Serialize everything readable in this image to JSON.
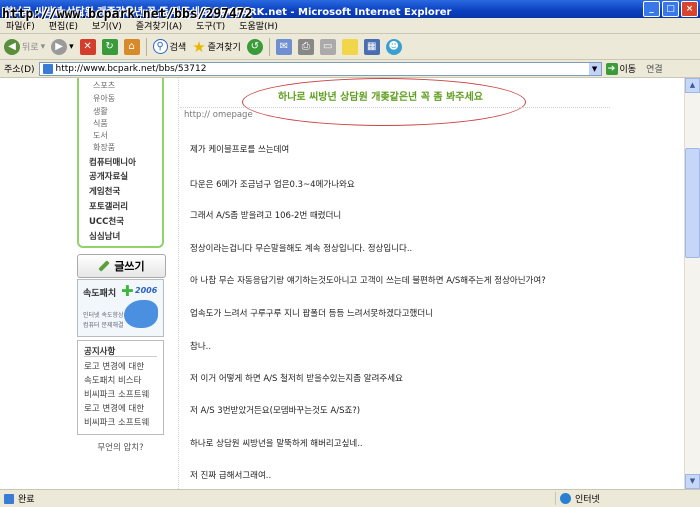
{
  "window": {
    "title": "하나로 씨방년 상담원 개좆같은년 꼭 좀 봐주세요 : BCPARK.net - Microsoft Internet Explorer",
    "watermark_url": "http://www.bcpark.net/bbs/297472",
    "buttons": [
      "_",
      "□",
      "×"
    ]
  },
  "menubar": [
    "파일(F)",
    "편집(E)",
    "보기(V)",
    "즐겨찾기(A)",
    "도구(T)",
    "도움말(H)"
  ],
  "toolbar": {
    "back": "뒤로",
    "search": "검색",
    "favorites": "즐겨찾기"
  },
  "address": {
    "label": "주소(D)",
    "url": "http://www.bcpark.net/bbs/53712",
    "go": "이동",
    "links": "연결"
  },
  "sidebar": {
    "subcategories": [
      "스포츠",
      "유아동",
      "생활",
      "식품",
      "도서",
      "화장품"
    ],
    "categories": [
      "컴퓨터매니아",
      "공개자료실",
      "게임천국",
      "포토갤러리",
      "UCC천국",
      "심심남녀"
    ],
    "write_button": "글쓰기",
    "banner": {
      "title": "속도패치",
      "year": "2006",
      "line1": "인터넷 속도향상",
      "line2": "컴퓨터 문제해결"
    },
    "notice": {
      "title": "공지사항",
      "items": [
        "로고 변경에 대한",
        "속도패치 비스타",
        "비씨파크 소프트웨",
        "로고 변경에 대한",
        "비씨파크 소프트웨"
      ]
    },
    "unknown": "무언의 압치?"
  },
  "post": {
    "title": "하나로 씨방년 상담원 개좆같은년 꼭 좀 봐주세요",
    "homepage": "http:// omepage",
    "paragraphs": [
      "제가 케이블프로를 쓰는데여",
      "다운은 6메가 조금넘구 업은0.3~4메가나와요",
      "그래서 A/S좀 받을려고 106-2번 때렸더니",
      "정상이라는겁니다 무슨말을해도 계속 정상입니다. 정상입니다..",
      "아 나참 무슨 자동응답기랑 얘기하는것도아니고 고객이 쓰는데 불편하면 A/S해주는게 정상아닌가여?",
      "업속도가 느려서 구루구루 지니 팝폴더 등등 느려서못하겠다고했더니",
      "참나..",
      "저 이거 어떻게 하면 A/S 철저히 받을수있는지좀 알려주세요",
      "저 A/S 3번받았거든요(모뎀바꾸는것도 A/S죠?)",
      "하나로 상담원 씨방년을 말뚝하게 해버리고싶네..",
      "저 진짜 급해서그래여.."
    ]
  },
  "statusbar": {
    "status": "완료",
    "zone": "인터넷"
  }
}
